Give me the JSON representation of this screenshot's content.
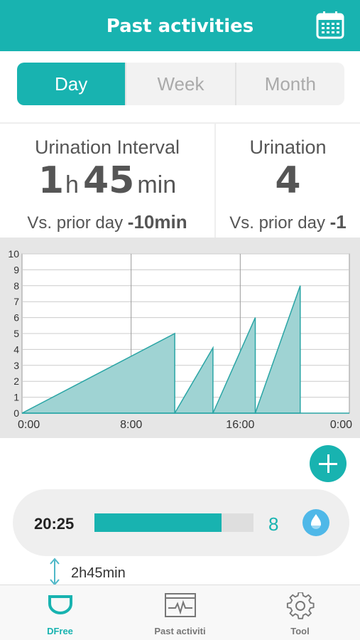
{
  "header": {
    "title": "Past activities",
    "calendar_icon": "calendar-icon"
  },
  "segments": [
    {
      "label": "Day",
      "active": true
    },
    {
      "label": "Week",
      "active": false
    },
    {
      "label": "Month",
      "active": false
    }
  ],
  "stats": {
    "interval": {
      "label": "Urination Interval",
      "hours": "1",
      "hours_unit": "h",
      "minutes": "45",
      "minutes_unit": "min",
      "vs_label": "Vs. prior day",
      "vs_value": "-10min"
    },
    "count": {
      "label": "Urination",
      "value": "4",
      "vs_label": "Vs. prior day",
      "vs_value": "-1"
    }
  },
  "chart_data": {
    "type": "area",
    "x_ticks": [
      "0:00",
      "8:00",
      "16:00",
      "0:00"
    ],
    "y_ticks": [
      "0",
      "1",
      "2",
      "3",
      "4",
      "5",
      "6",
      "7",
      "8",
      "9",
      "10"
    ],
    "ylim": [
      0,
      10
    ],
    "xlim_hours": [
      0,
      24
    ],
    "grid": true,
    "fill_color": "#9fd3d3",
    "line_color": "#2aa5a5",
    "segments": [
      {
        "points": [
          [
            0,
            0
          ],
          [
            11.2,
            5
          ],
          [
            11.2,
            0
          ]
        ]
      },
      {
        "points": [
          [
            11.2,
            0
          ],
          [
            14.0,
            4.1
          ],
          [
            14.0,
            0
          ]
        ]
      },
      {
        "points": [
          [
            14.0,
            0
          ],
          [
            17.1,
            6
          ],
          [
            17.1,
            0
          ]
        ]
      },
      {
        "points": [
          [
            17.1,
            0
          ],
          [
            20.4,
            8
          ],
          [
            20.4,
            0
          ]
        ]
      }
    ]
  },
  "add_button": {
    "icon": "plus-icon"
  },
  "record": {
    "time": "20:25",
    "level": 0.8,
    "count": "8",
    "icon": "water-drop-icon"
  },
  "interval_note": {
    "text": "2h45min"
  },
  "tabbar": [
    {
      "label": "DFree",
      "icon": "dfree-device-icon",
      "active": true
    },
    {
      "label": "Past activiti",
      "icon": "activity-chart-icon",
      "active": false
    },
    {
      "label": "Tool",
      "icon": "gear-icon",
      "active": false
    }
  ],
  "colors": {
    "accent": "#18b3b0",
    "chart_bg": "#e6e6e6"
  }
}
